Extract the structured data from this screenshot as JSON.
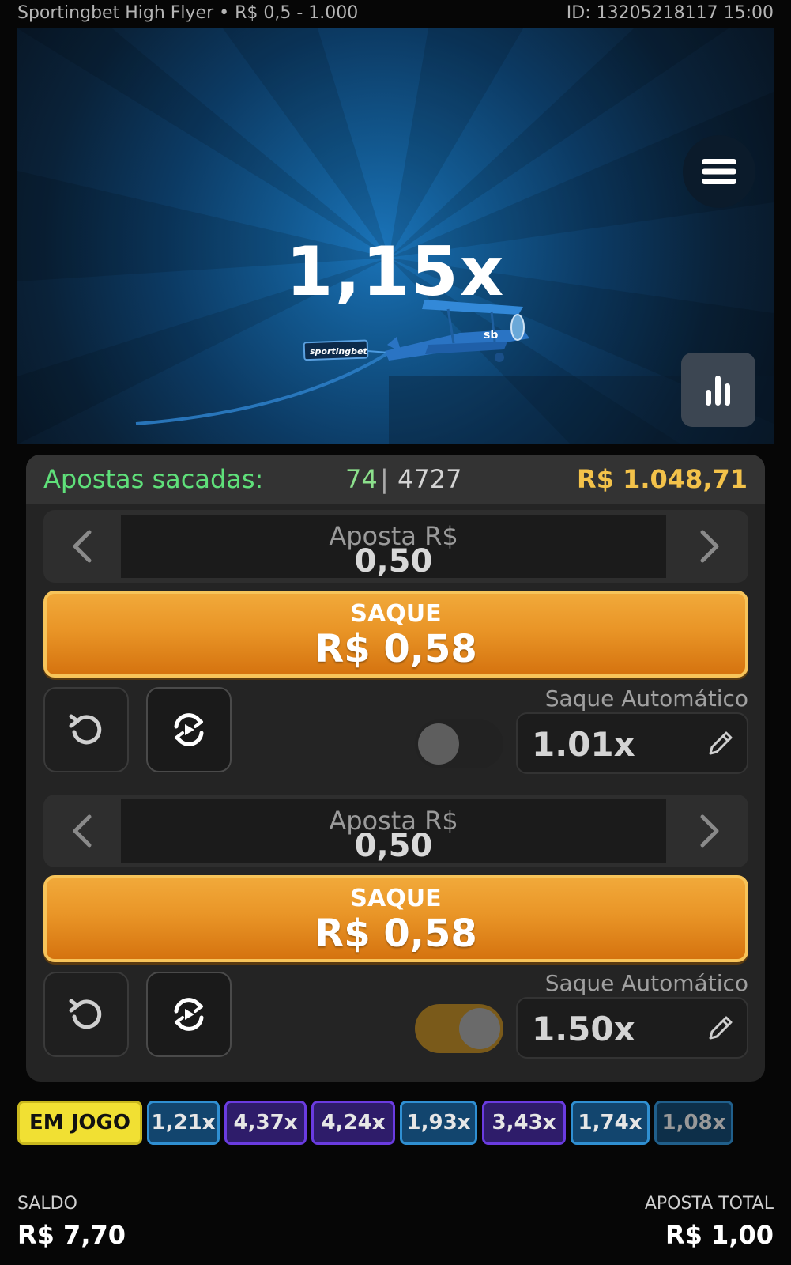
{
  "header": {
    "game_title": "Sportingbet High Flyer • R$ 0,5 - 1.000",
    "round_id": "ID: 13205218117 15:00"
  },
  "game": {
    "multiplier": "1,15x",
    "plane_banner": "sportingbet",
    "plane_logo": "sb",
    "menu_icon": "hamburger-menu-icon",
    "stats_icon": "bar-chart-icon"
  },
  "summary": {
    "label": "Apostas sacadas:",
    "cashed_count": "74",
    "separator": "|",
    "total_count": "4727",
    "amount": "R$ 1.048,71"
  },
  "bets": [
    {
      "stake_label": "Aposta R$",
      "stake_value": "0,50",
      "cashout_title": "SAQUE",
      "cashout_amount": "R$ 0,58",
      "auto_label": "Saque Automático",
      "auto_value": "1.01x",
      "auto_enabled": false
    },
    {
      "stake_label": "Aposta R$",
      "stake_value": "0,50",
      "cashout_title": "SAQUE",
      "cashout_amount": "R$ 0,58",
      "auto_label": "Saque Automático",
      "auto_value": "1.50x",
      "auto_enabled": true
    }
  ],
  "history": {
    "live_label": "EM JOGO",
    "values": [
      "1,21x",
      "4,37x",
      "4,24x",
      "1,93x",
      "3,43x",
      "1,74x",
      "1,08x"
    ]
  },
  "footer": {
    "balance_label": "SALDO",
    "balance_value": "R$ 7,70",
    "total_bet_label": "APOSTA TOTAL",
    "total_bet_value": "R$ 1,00"
  },
  "colors": {
    "accent_orange": "#e99527",
    "cashed_green": "#5fe07a",
    "amount_gold": "#f3c24a",
    "live_yellow": "#f1e033"
  }
}
